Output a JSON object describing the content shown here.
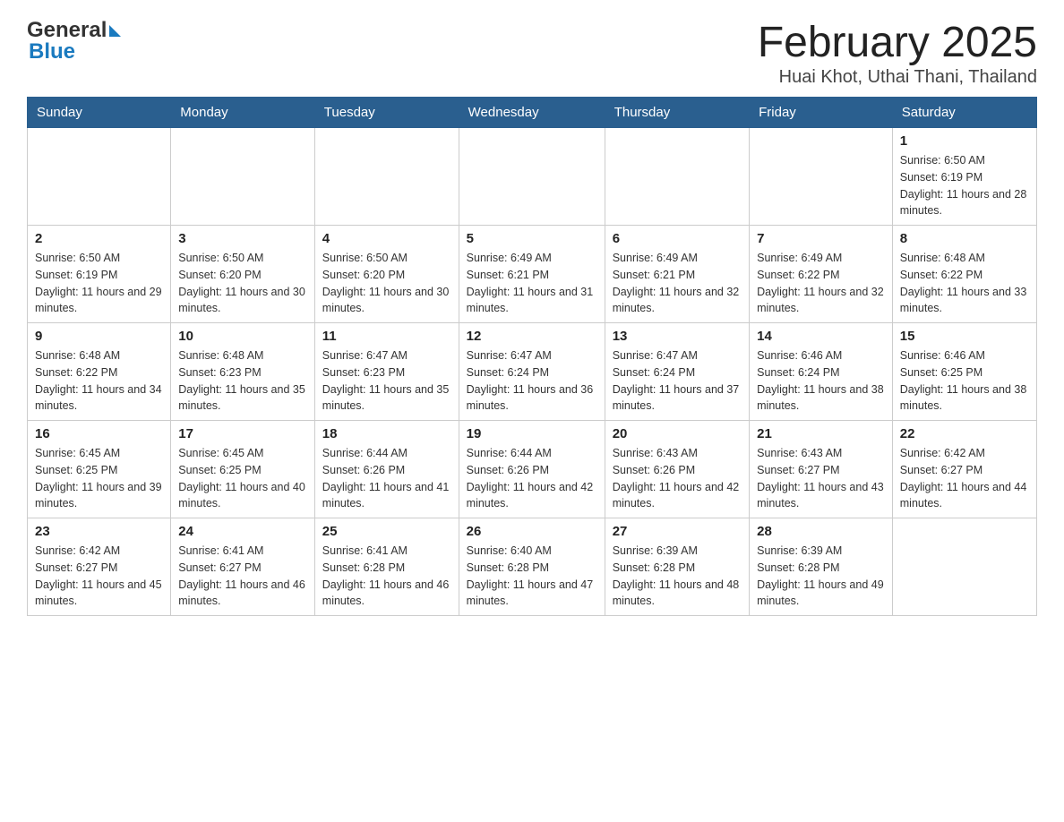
{
  "header": {
    "logo_general": "General",
    "logo_blue": "Blue",
    "title": "February 2025",
    "subtitle": "Huai Khot, Uthai Thani, Thailand"
  },
  "weekdays": [
    "Sunday",
    "Monday",
    "Tuesday",
    "Wednesday",
    "Thursday",
    "Friday",
    "Saturday"
  ],
  "weeks": [
    [
      {
        "day": "",
        "info": ""
      },
      {
        "day": "",
        "info": ""
      },
      {
        "day": "",
        "info": ""
      },
      {
        "day": "",
        "info": ""
      },
      {
        "day": "",
        "info": ""
      },
      {
        "day": "",
        "info": ""
      },
      {
        "day": "1",
        "info": "Sunrise: 6:50 AM\nSunset: 6:19 PM\nDaylight: 11 hours and 28 minutes."
      }
    ],
    [
      {
        "day": "2",
        "info": "Sunrise: 6:50 AM\nSunset: 6:19 PM\nDaylight: 11 hours and 29 minutes."
      },
      {
        "day": "3",
        "info": "Sunrise: 6:50 AM\nSunset: 6:20 PM\nDaylight: 11 hours and 30 minutes."
      },
      {
        "day": "4",
        "info": "Sunrise: 6:50 AM\nSunset: 6:20 PM\nDaylight: 11 hours and 30 minutes."
      },
      {
        "day": "5",
        "info": "Sunrise: 6:49 AM\nSunset: 6:21 PM\nDaylight: 11 hours and 31 minutes."
      },
      {
        "day": "6",
        "info": "Sunrise: 6:49 AM\nSunset: 6:21 PM\nDaylight: 11 hours and 32 minutes."
      },
      {
        "day": "7",
        "info": "Sunrise: 6:49 AM\nSunset: 6:22 PM\nDaylight: 11 hours and 32 minutes."
      },
      {
        "day": "8",
        "info": "Sunrise: 6:48 AM\nSunset: 6:22 PM\nDaylight: 11 hours and 33 minutes."
      }
    ],
    [
      {
        "day": "9",
        "info": "Sunrise: 6:48 AM\nSunset: 6:22 PM\nDaylight: 11 hours and 34 minutes."
      },
      {
        "day": "10",
        "info": "Sunrise: 6:48 AM\nSunset: 6:23 PM\nDaylight: 11 hours and 35 minutes."
      },
      {
        "day": "11",
        "info": "Sunrise: 6:47 AM\nSunset: 6:23 PM\nDaylight: 11 hours and 35 minutes."
      },
      {
        "day": "12",
        "info": "Sunrise: 6:47 AM\nSunset: 6:24 PM\nDaylight: 11 hours and 36 minutes."
      },
      {
        "day": "13",
        "info": "Sunrise: 6:47 AM\nSunset: 6:24 PM\nDaylight: 11 hours and 37 minutes."
      },
      {
        "day": "14",
        "info": "Sunrise: 6:46 AM\nSunset: 6:24 PM\nDaylight: 11 hours and 38 minutes."
      },
      {
        "day": "15",
        "info": "Sunrise: 6:46 AM\nSunset: 6:25 PM\nDaylight: 11 hours and 38 minutes."
      }
    ],
    [
      {
        "day": "16",
        "info": "Sunrise: 6:45 AM\nSunset: 6:25 PM\nDaylight: 11 hours and 39 minutes."
      },
      {
        "day": "17",
        "info": "Sunrise: 6:45 AM\nSunset: 6:25 PM\nDaylight: 11 hours and 40 minutes."
      },
      {
        "day": "18",
        "info": "Sunrise: 6:44 AM\nSunset: 6:26 PM\nDaylight: 11 hours and 41 minutes."
      },
      {
        "day": "19",
        "info": "Sunrise: 6:44 AM\nSunset: 6:26 PM\nDaylight: 11 hours and 42 minutes."
      },
      {
        "day": "20",
        "info": "Sunrise: 6:43 AM\nSunset: 6:26 PM\nDaylight: 11 hours and 42 minutes."
      },
      {
        "day": "21",
        "info": "Sunrise: 6:43 AM\nSunset: 6:27 PM\nDaylight: 11 hours and 43 minutes."
      },
      {
        "day": "22",
        "info": "Sunrise: 6:42 AM\nSunset: 6:27 PM\nDaylight: 11 hours and 44 minutes."
      }
    ],
    [
      {
        "day": "23",
        "info": "Sunrise: 6:42 AM\nSunset: 6:27 PM\nDaylight: 11 hours and 45 minutes."
      },
      {
        "day": "24",
        "info": "Sunrise: 6:41 AM\nSunset: 6:27 PM\nDaylight: 11 hours and 46 minutes."
      },
      {
        "day": "25",
        "info": "Sunrise: 6:41 AM\nSunset: 6:28 PM\nDaylight: 11 hours and 46 minutes."
      },
      {
        "day": "26",
        "info": "Sunrise: 6:40 AM\nSunset: 6:28 PM\nDaylight: 11 hours and 47 minutes."
      },
      {
        "day": "27",
        "info": "Sunrise: 6:39 AM\nSunset: 6:28 PM\nDaylight: 11 hours and 48 minutes."
      },
      {
        "day": "28",
        "info": "Sunrise: 6:39 AM\nSunset: 6:28 PM\nDaylight: 11 hours and 49 minutes."
      },
      {
        "day": "",
        "info": ""
      }
    ]
  ]
}
